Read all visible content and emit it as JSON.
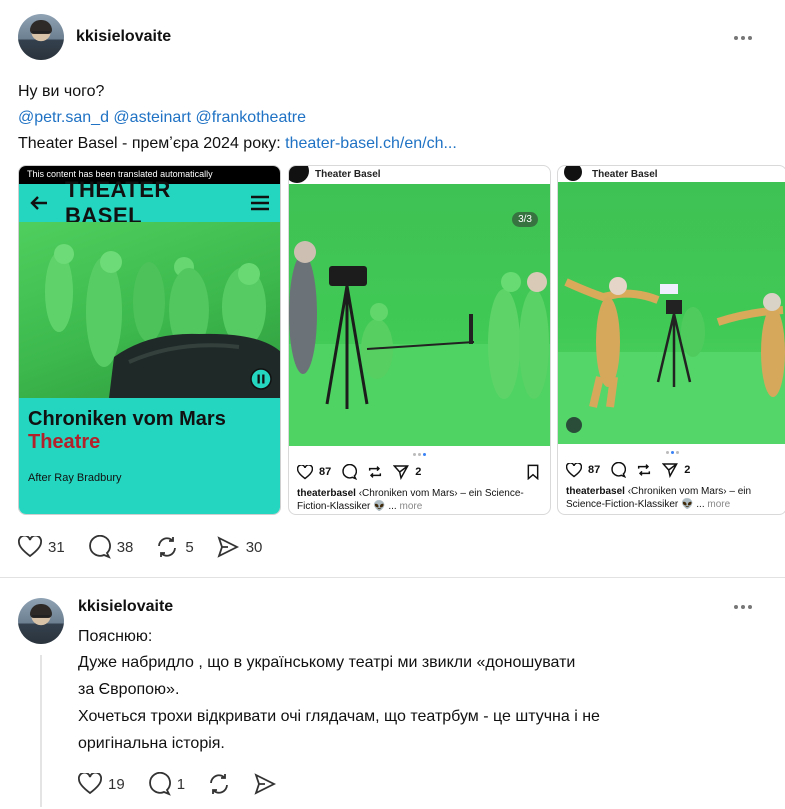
{
  "post": {
    "username": "kkisielovaite",
    "line1": "Ну ви чого?",
    "mentions": [
      "@petr.san_d",
      "@asteinart",
      "@frankotheatre"
    ],
    "line3_prefix": "Theater Basel - премʼєра 2024 року: ",
    "link": "theater-basel.ch/en/ch...",
    "stats": {
      "likes": "31",
      "comments": "38",
      "reposts": "5",
      "shares": "30"
    }
  },
  "card1": {
    "banner": "This content has been translated automatically",
    "brand": "THEATER BASEL",
    "title": "Chroniken vom Mars",
    "subtitle": "Theatre",
    "author": "After Ray Bradbury"
  },
  "card2": {
    "account": "Theater Basel",
    "counter": "3/3",
    "likes": "87",
    "shares": "2",
    "caption_user": "theaterbasel",
    "caption_text": " ‹Chroniken vom Mars› – ein Science-Fiction-Klassiker 👽 ...",
    "more": "more"
  },
  "card3": {
    "account": "Theater Basel",
    "likes": "87",
    "shares": "2",
    "caption_user": "theaterbasel",
    "caption_text": " ‹Chroniken vom Mars› – ein Science-Fiction-Klassiker 👽 ...",
    "more": "more"
  },
  "reply": {
    "username": "kkisielovaite",
    "lines": [
      "Пояснюю:",
      "Дуже набридло , що в українському театрі ми звикли «доношувати",
      "за Європою».",
      "Хочеться трохи відкривати очі глядачам, що театрбум - це штучна і не",
      "оригінальна історія."
    ],
    "stats": {
      "likes": "19",
      "comments": "1"
    }
  }
}
